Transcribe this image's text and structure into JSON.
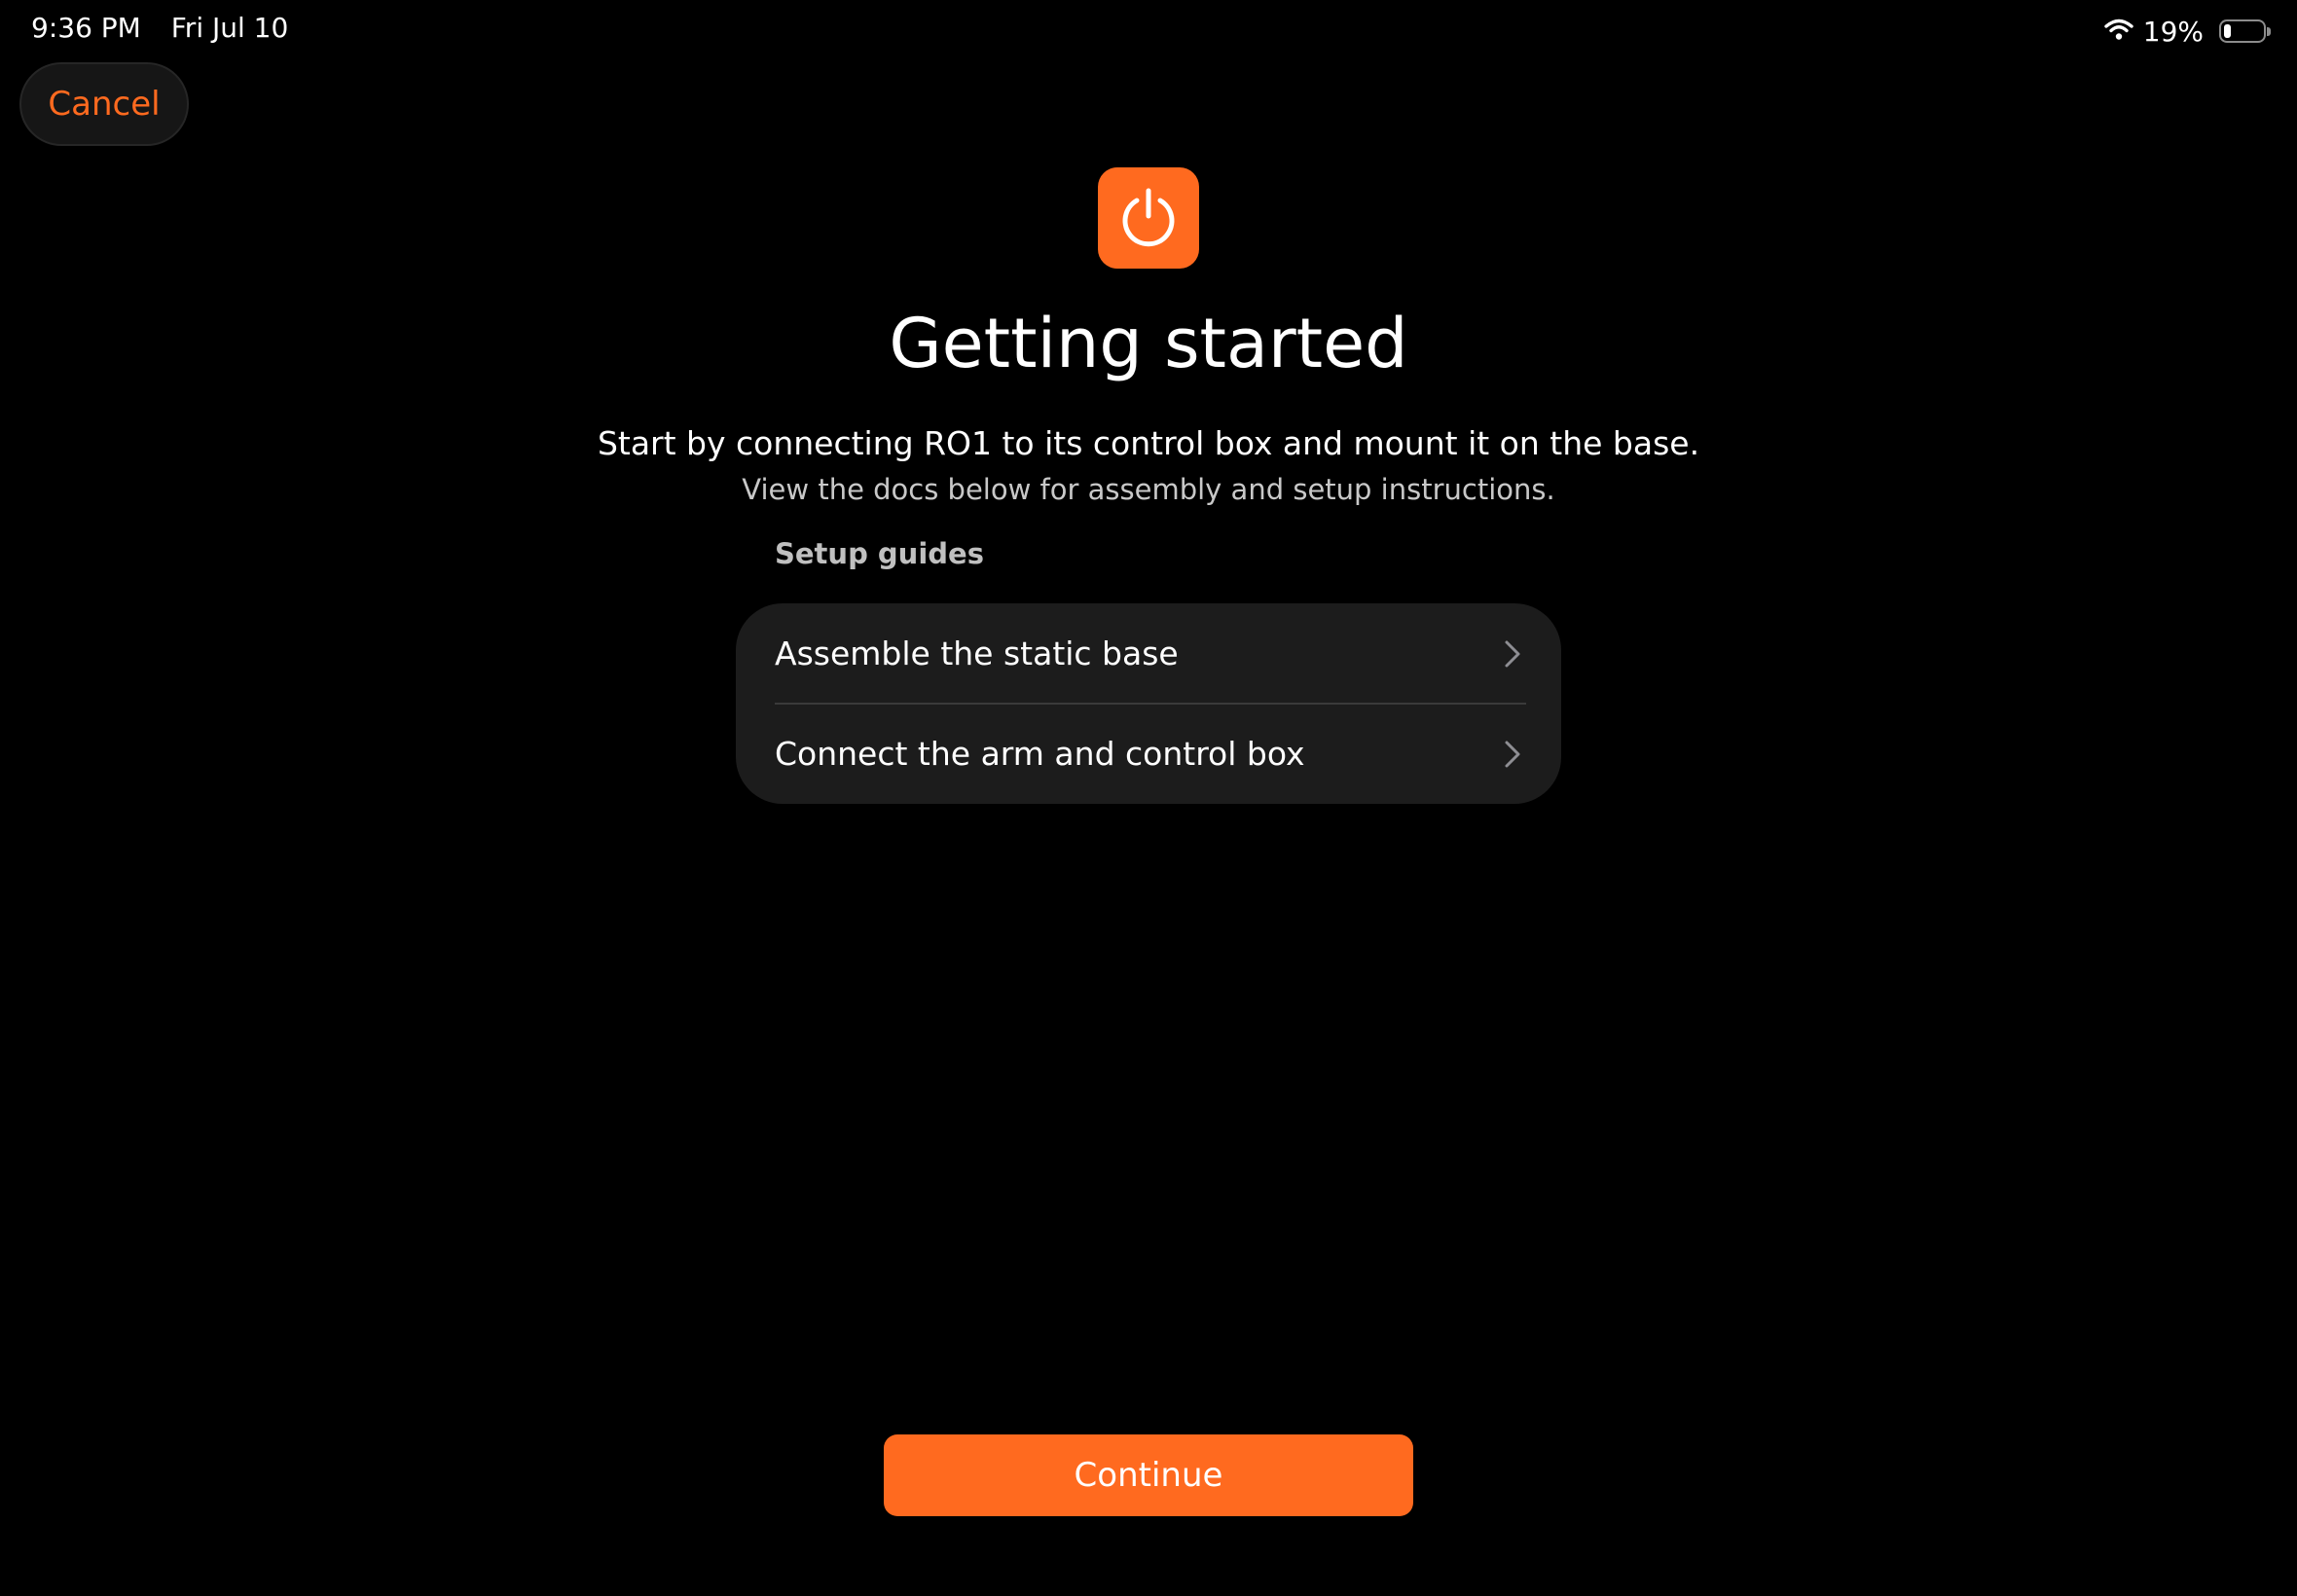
{
  "status_bar": {
    "time": "9:36 PM",
    "date": "Fri Jul 10",
    "battery_percent": "19%",
    "battery_level": 0.19,
    "wifi_icon": "wifi-icon",
    "battery_icon": "battery-icon"
  },
  "nav": {
    "cancel_label": "Cancel"
  },
  "header": {
    "icon": "power-icon",
    "title": "Getting started",
    "subtitle": "Start by connecting RO1 to its control box and mount it on the base.",
    "description": "View the docs below for assembly and setup instructions."
  },
  "setup_guides": {
    "header": "Setup guides",
    "items": [
      {
        "label": "Assemble the static base",
        "icon": "chevron-right-icon"
      },
      {
        "label": "Connect the arm and control box",
        "icon": "chevron-right-icon"
      }
    ]
  },
  "footer": {
    "continue_label": "Continue"
  },
  "colors": {
    "accent": "#FF6A1F",
    "background": "#000000",
    "card": "#1C1C1C"
  }
}
